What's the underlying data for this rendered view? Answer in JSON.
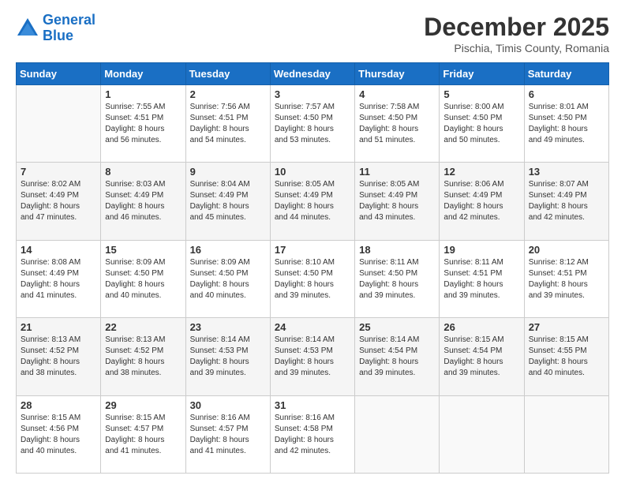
{
  "logo": {
    "line1": "General",
    "line2": "Blue"
  },
  "title": "December 2025",
  "location": "Pischia, Timis County, Romania",
  "days_header": [
    "Sunday",
    "Monday",
    "Tuesday",
    "Wednesday",
    "Thursday",
    "Friday",
    "Saturday"
  ],
  "weeks": [
    [
      {
        "day": "",
        "sunrise": "",
        "sunset": "",
        "daylight": ""
      },
      {
        "day": "1",
        "sunrise": "Sunrise: 7:55 AM",
        "sunset": "Sunset: 4:51 PM",
        "daylight": "Daylight: 8 hours and 56 minutes."
      },
      {
        "day": "2",
        "sunrise": "Sunrise: 7:56 AM",
        "sunset": "Sunset: 4:51 PM",
        "daylight": "Daylight: 8 hours and 54 minutes."
      },
      {
        "day": "3",
        "sunrise": "Sunrise: 7:57 AM",
        "sunset": "Sunset: 4:50 PM",
        "daylight": "Daylight: 8 hours and 53 minutes."
      },
      {
        "day": "4",
        "sunrise": "Sunrise: 7:58 AM",
        "sunset": "Sunset: 4:50 PM",
        "daylight": "Daylight: 8 hours and 51 minutes."
      },
      {
        "day": "5",
        "sunrise": "Sunrise: 8:00 AM",
        "sunset": "Sunset: 4:50 PM",
        "daylight": "Daylight: 8 hours and 50 minutes."
      },
      {
        "day": "6",
        "sunrise": "Sunrise: 8:01 AM",
        "sunset": "Sunset: 4:50 PM",
        "daylight": "Daylight: 8 hours and 49 minutes."
      }
    ],
    [
      {
        "day": "7",
        "sunrise": "Sunrise: 8:02 AM",
        "sunset": "Sunset: 4:49 PM",
        "daylight": "Daylight: 8 hours and 47 minutes."
      },
      {
        "day": "8",
        "sunrise": "Sunrise: 8:03 AM",
        "sunset": "Sunset: 4:49 PM",
        "daylight": "Daylight: 8 hours and 46 minutes."
      },
      {
        "day": "9",
        "sunrise": "Sunrise: 8:04 AM",
        "sunset": "Sunset: 4:49 PM",
        "daylight": "Daylight: 8 hours and 45 minutes."
      },
      {
        "day": "10",
        "sunrise": "Sunrise: 8:05 AM",
        "sunset": "Sunset: 4:49 PM",
        "daylight": "Daylight: 8 hours and 44 minutes."
      },
      {
        "day": "11",
        "sunrise": "Sunrise: 8:05 AM",
        "sunset": "Sunset: 4:49 PM",
        "daylight": "Daylight: 8 hours and 43 minutes."
      },
      {
        "day": "12",
        "sunrise": "Sunrise: 8:06 AM",
        "sunset": "Sunset: 4:49 PM",
        "daylight": "Daylight: 8 hours and 42 minutes."
      },
      {
        "day": "13",
        "sunrise": "Sunrise: 8:07 AM",
        "sunset": "Sunset: 4:49 PM",
        "daylight": "Daylight: 8 hours and 42 minutes."
      }
    ],
    [
      {
        "day": "14",
        "sunrise": "Sunrise: 8:08 AM",
        "sunset": "Sunset: 4:49 PM",
        "daylight": "Daylight: 8 hours and 41 minutes."
      },
      {
        "day": "15",
        "sunrise": "Sunrise: 8:09 AM",
        "sunset": "Sunset: 4:50 PM",
        "daylight": "Daylight: 8 hours and 40 minutes."
      },
      {
        "day": "16",
        "sunrise": "Sunrise: 8:09 AM",
        "sunset": "Sunset: 4:50 PM",
        "daylight": "Daylight: 8 hours and 40 minutes."
      },
      {
        "day": "17",
        "sunrise": "Sunrise: 8:10 AM",
        "sunset": "Sunset: 4:50 PM",
        "daylight": "Daylight: 8 hours and 39 minutes."
      },
      {
        "day": "18",
        "sunrise": "Sunrise: 8:11 AM",
        "sunset": "Sunset: 4:50 PM",
        "daylight": "Daylight: 8 hours and 39 minutes."
      },
      {
        "day": "19",
        "sunrise": "Sunrise: 8:11 AM",
        "sunset": "Sunset: 4:51 PM",
        "daylight": "Daylight: 8 hours and 39 minutes."
      },
      {
        "day": "20",
        "sunrise": "Sunrise: 8:12 AM",
        "sunset": "Sunset: 4:51 PM",
        "daylight": "Daylight: 8 hours and 39 minutes."
      }
    ],
    [
      {
        "day": "21",
        "sunrise": "Sunrise: 8:13 AM",
        "sunset": "Sunset: 4:52 PM",
        "daylight": "Daylight: 8 hours and 38 minutes."
      },
      {
        "day": "22",
        "sunrise": "Sunrise: 8:13 AM",
        "sunset": "Sunset: 4:52 PM",
        "daylight": "Daylight: 8 hours and 38 minutes."
      },
      {
        "day": "23",
        "sunrise": "Sunrise: 8:14 AM",
        "sunset": "Sunset: 4:53 PM",
        "daylight": "Daylight: 8 hours and 39 minutes."
      },
      {
        "day": "24",
        "sunrise": "Sunrise: 8:14 AM",
        "sunset": "Sunset: 4:53 PM",
        "daylight": "Daylight: 8 hours and 39 minutes."
      },
      {
        "day": "25",
        "sunrise": "Sunrise: 8:14 AM",
        "sunset": "Sunset: 4:54 PM",
        "daylight": "Daylight: 8 hours and 39 minutes."
      },
      {
        "day": "26",
        "sunrise": "Sunrise: 8:15 AM",
        "sunset": "Sunset: 4:54 PM",
        "daylight": "Daylight: 8 hours and 39 minutes."
      },
      {
        "day": "27",
        "sunrise": "Sunrise: 8:15 AM",
        "sunset": "Sunset: 4:55 PM",
        "daylight": "Daylight: 8 hours and 40 minutes."
      }
    ],
    [
      {
        "day": "28",
        "sunrise": "Sunrise: 8:15 AM",
        "sunset": "Sunset: 4:56 PM",
        "daylight": "Daylight: 8 hours and 40 minutes."
      },
      {
        "day": "29",
        "sunrise": "Sunrise: 8:15 AM",
        "sunset": "Sunset: 4:57 PM",
        "daylight": "Daylight: 8 hours and 41 minutes."
      },
      {
        "day": "30",
        "sunrise": "Sunrise: 8:16 AM",
        "sunset": "Sunset: 4:57 PM",
        "daylight": "Daylight: 8 hours and 41 minutes."
      },
      {
        "day": "31",
        "sunrise": "Sunrise: 8:16 AM",
        "sunset": "Sunset: 4:58 PM",
        "daylight": "Daylight: 8 hours and 42 minutes."
      },
      {
        "day": "",
        "sunrise": "",
        "sunset": "",
        "daylight": ""
      },
      {
        "day": "",
        "sunrise": "",
        "sunset": "",
        "daylight": ""
      },
      {
        "day": "",
        "sunrise": "",
        "sunset": "",
        "daylight": ""
      }
    ]
  ]
}
